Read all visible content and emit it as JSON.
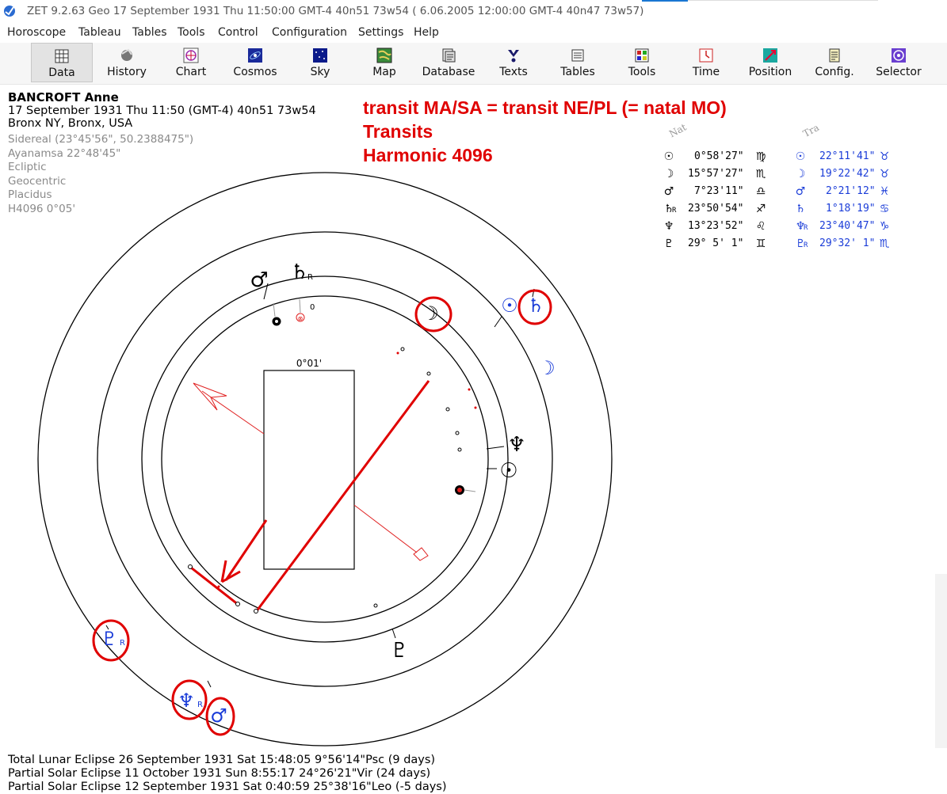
{
  "window": {
    "title": "ZET 9.2.63 Geo   17 September 1931  Thu  11:50:00 GMT-4 40n51  73w54  ( 6.06.2005  12:00:00 GMT-4 40n47 73w57)"
  },
  "menu": [
    "Horoscope",
    "Tableau",
    "Tables",
    "Tools",
    "Control",
    "Configuration",
    "Settings",
    "Help"
  ],
  "toolbar": [
    {
      "label": "Data",
      "icon": "data-grid-icon",
      "active": true
    },
    {
      "label": "History",
      "icon": "history-icon"
    },
    {
      "label": "Chart",
      "icon": "chart-wheel-icon"
    },
    {
      "label": "Cosmos",
      "icon": "cosmos-icon"
    },
    {
      "label": "Sky",
      "icon": "sky-icon"
    },
    {
      "label": "Map",
      "icon": "map-icon"
    },
    {
      "label": "Database",
      "icon": "database-icon"
    },
    {
      "label": "Texts",
      "icon": "texts-icon"
    },
    {
      "label": "Tables",
      "icon": "tables-icon"
    },
    {
      "label": "Tools",
      "icon": "tools-icon"
    },
    {
      "label": "Time",
      "icon": "time-icon"
    },
    {
      "label": "Position",
      "icon": "position-icon"
    },
    {
      "label": "Config.",
      "icon": "config-icon"
    },
    {
      "label": "Selector",
      "icon": "selector-icon"
    }
  ],
  "info": {
    "name": "BANCROFT Anne",
    "datetime": "17 September 1931  Thu  11:50 (GMT-4) 40n51  73w54",
    "place": "Bronx NY, Bronx, USA",
    "settings": [
      "Sidereal (23°45'56\", 50.2388475\")",
      "Ayanamsa 22°48'45\"",
      "Ecliptic",
      "Geocentric",
      "Placidus",
      "H4096   0°05'"
    ]
  },
  "annotation": {
    "line1": "transit MA/SA = transit NE/PL (= natal MO)",
    "line2": "Transits",
    "line3": "Harmonic 4096"
  },
  "wheel": {
    "box_label": "0°01'",
    "zero_label": "0",
    "retro_mark": "R"
  },
  "positions": {
    "header_natal": "Nat",
    "header_transit": "Tra",
    "natal": [
      {
        "glyph": "☉",
        "value": "0°58'27\"",
        "sign": "♍"
      },
      {
        "glyph": "☽",
        "value": "15°57'27\"",
        "sign": "♏"
      },
      {
        "glyph": "♂",
        "value": "7°23'11\"",
        "sign": "♎"
      },
      {
        "glyph": "♄",
        "retro": "R",
        "value": "23°50'54\"",
        "sign": "♐"
      },
      {
        "glyph": "♆",
        "value": "13°23'52\"",
        "sign": "♌"
      },
      {
        "glyph": "♇",
        "value": "29° 5' 1\"",
        "sign": "♊"
      }
    ],
    "transit": [
      {
        "glyph": "☉",
        "value": "22°11'41\"",
        "sign": "♉"
      },
      {
        "glyph": "☽",
        "value": "19°22'42\"",
        "sign": "♉"
      },
      {
        "glyph": "♂",
        "value": "2°21'12\"",
        "sign": "♓"
      },
      {
        "glyph": "♄",
        "value": "1°18'19\"",
        "sign": "♋"
      },
      {
        "glyph": "♆",
        "retro": "R",
        "value": "23°40'47\"",
        "sign": "♑"
      },
      {
        "glyph": "♇",
        "retro": "R",
        "value": "29°32' 1\"",
        "sign": "♏"
      }
    ]
  },
  "eclipses": [
    "Total Lunar Eclipse 26 September 1931 Sat 15:48:05  9°56'14\"Psc (9 days)",
    "Partial Solar Eclipse 11 October 1931 Sun  8:55:17 24°26'21\"Vir (24 days)",
    "Partial Solar Eclipse 12 September 1931 Sat  0:40:59 25°38'16\"Leo (-5 days)"
  ],
  "colors": {
    "annotation_red": "#e00000",
    "transit_blue": "#1a3cd8",
    "natal_black": "#000000"
  }
}
